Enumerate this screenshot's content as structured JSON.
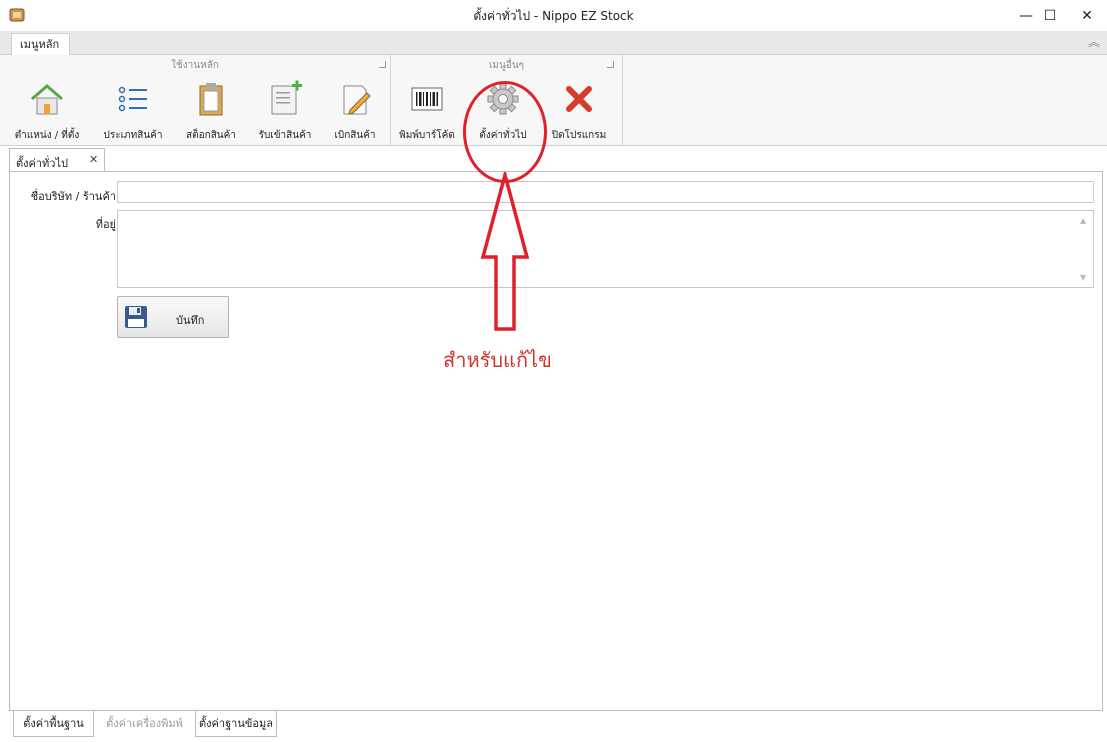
{
  "window": {
    "title": "ตั้งค่าทั่วไป - Nippo EZ Stock",
    "minimize_glyph": "—",
    "maximize_glyph": "☐",
    "close_glyph": "✕"
  },
  "ribbon_tab": {
    "label": "เมนูหลัก"
  },
  "ribbon": {
    "groups": [
      {
        "label": "ใช้งานหลัก"
      },
      {
        "label": "เมนูอื่นๆ"
      }
    ],
    "buttons": [
      {
        "label": "ตำแหน่ง / ที่ตั้ง",
        "icon": "home-icon"
      },
      {
        "label": "ประเภทสินค้า",
        "icon": "list-icon"
      },
      {
        "label": "สต็อกสินค้า",
        "icon": "clipboard-icon"
      },
      {
        "label": "รับเข้าสินค้า",
        "icon": "document-add-icon"
      },
      {
        "label": "เบิกสินค้า",
        "icon": "pencil-document-icon"
      },
      {
        "label": "พิมพ์บาร์โค้ด",
        "icon": "barcode-icon"
      },
      {
        "label": "ตั้งค่าทั่วไป",
        "icon": "gear-icon"
      },
      {
        "label": "ปิดโปรแกรม",
        "icon": "close-red-icon"
      }
    ]
  },
  "doc_tab": {
    "label": "ตั้งค่าทั่วไป",
    "close_glyph": "✕"
  },
  "form": {
    "company_label": "ชื่อบริษัท / ร้านค้า",
    "company_value": "",
    "address_label": "ที่อยู่",
    "address_value": "",
    "save_label": "บันทึก"
  },
  "annotation": {
    "text": "สำหรับแก้ไข",
    "color": "#e0202a"
  },
  "bottom_tabs": [
    {
      "label": "ตั้งค่าพื้นฐาน",
      "active": true
    },
    {
      "label": "ตั้งค่าเครื่องพิมพ์",
      "active": false
    },
    {
      "label": "ตั้งค่าฐานข้อมูล",
      "active": true
    }
  ]
}
